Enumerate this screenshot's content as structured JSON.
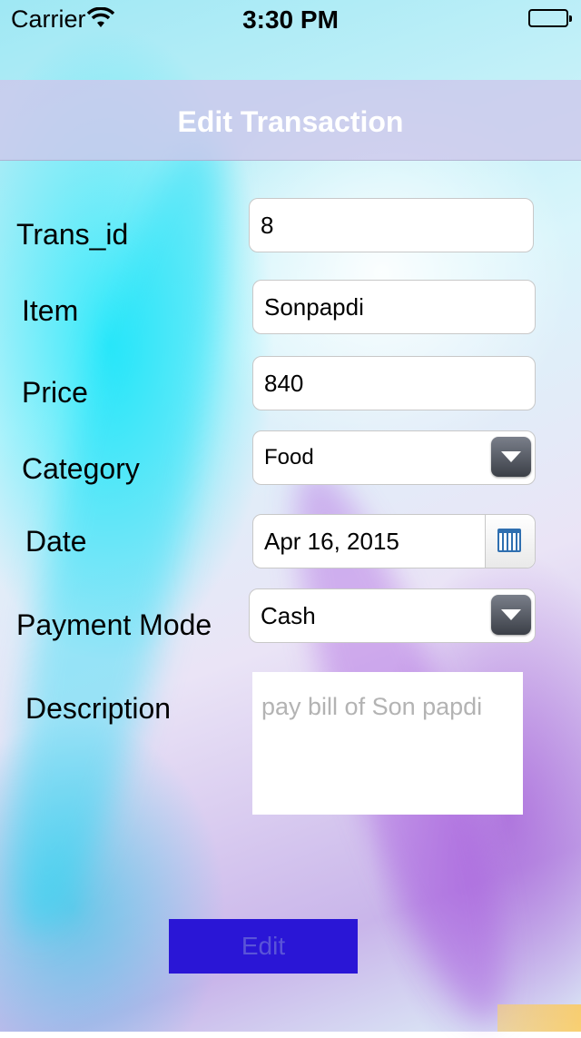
{
  "status_bar": {
    "carrier": "Carrier",
    "time": "3:30 PM",
    "icons": [
      "wifi-icon",
      "battery-icon"
    ]
  },
  "nav": {
    "title": "Edit Transaction"
  },
  "form": {
    "trans_id": {
      "label": "Trans_id",
      "value": "8"
    },
    "item": {
      "label": "Item",
      "value": "Sonpapdi"
    },
    "price": {
      "label": "Price",
      "value": "840"
    },
    "category": {
      "label": "Category",
      "value": "Food",
      "icon": "chevron-down-icon"
    },
    "date": {
      "label": "Date",
      "value": "Apr 16, 2015",
      "icon": "calendar-icon"
    },
    "payment_mode": {
      "label": "Payment Mode",
      "value": "Cash",
      "icon": "chevron-down-icon"
    },
    "description": {
      "label": "Description",
      "value": "pay bill of Son papdi"
    }
  },
  "actions": {
    "edit_label": "Edit"
  },
  "colors": {
    "nav_bar": "#cdc8eb",
    "edit_button": "#2a16d6",
    "edit_text": "#5a54d8",
    "description_text": "#b3b3b3"
  }
}
